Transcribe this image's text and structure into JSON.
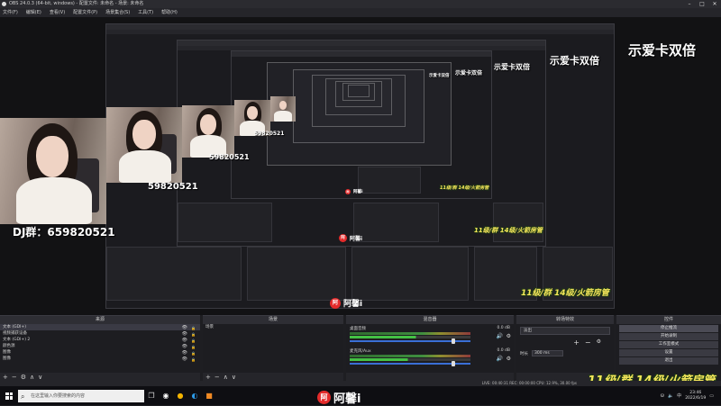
{
  "window": {
    "title": "OBS 24.0.3 (64-bit, windows) - 配置文件: 未命名 - 场景: 未命名",
    "minimize": "–",
    "maximize": "□",
    "close": "✕"
  },
  "menu": [
    "文件(F)",
    "编辑(E)",
    "查看(V)",
    "配置文件(P)",
    "场景集合(S)",
    "工具(T)",
    "帮助(H)"
  ],
  "overlay": {
    "promo_main": "示爱卡双倍",
    "dj_group": "DJ群：659820521",
    "qq_fragment": "59820521",
    "yellow_banner": "11级/群 14级/火箭房管",
    "logo_name": "阿馨i",
    "logo_char": "i"
  },
  "docks": {
    "scenes": {
      "title": "来源",
      "items": [
        "文本 (GDI+)",
        "视频捕获设备",
        "文本 (GDI+) 2",
        "颜色源",
        "图像",
        "图像"
      ]
    },
    "sources": {
      "title": "场景",
      "items": [
        "场景"
      ]
    },
    "mixer": {
      "title": "混音器",
      "channels": [
        {
          "name": "桌面音频",
          "db": "0.0 dB",
          "level": 0.55,
          "volume": 0.86
        },
        {
          "name": "麦克风/Aux",
          "db": "0.0 dB",
          "level": 0.48,
          "volume": 0.86
        }
      ]
    },
    "transitions": {
      "title": "转场特效",
      "type": "淡出",
      "duration_label": "时长",
      "duration_value": "300 ms"
    },
    "controls": {
      "title": "控件",
      "buttons": [
        "停止推流",
        "开始录制",
        "工作室模式",
        "设置",
        "退出"
      ]
    }
  },
  "tool_symbols": {
    "add": "+",
    "remove": "−",
    "settings": "⚙",
    "up": "∧",
    "down": "∨"
  },
  "statusbar": {
    "text": "LIVE: 00:40:31   REC: 00:00:00   CPU: 12.9%, 30.00 fps"
  },
  "taskbar": {
    "search_placeholder": "在这里输入你要搜索的内容",
    "time": "23:46",
    "date": "2022/6/19",
    "ime": "中"
  },
  "colors": {
    "accent_red": "#e32b2b",
    "banner_yellow": "#f5e65b",
    "meter_green": "#44c244"
  }
}
